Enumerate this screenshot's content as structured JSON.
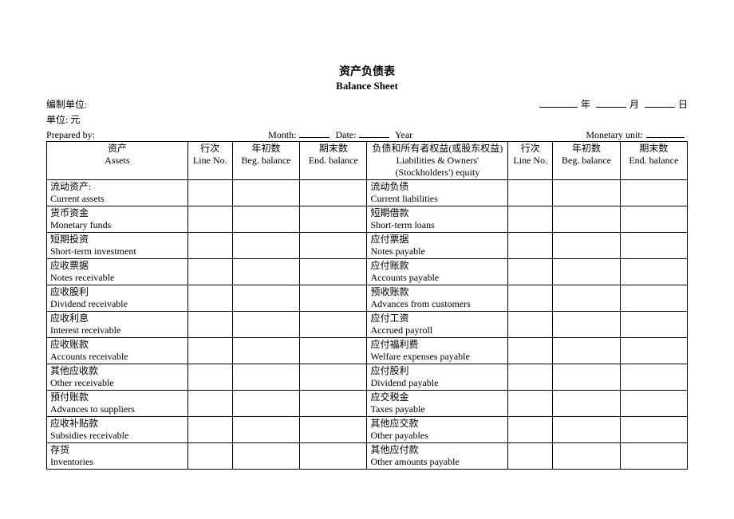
{
  "title_cn": "资产负债表",
  "title_en": "Balance Sheet",
  "meta": {
    "prep_unit_label": "编制单位:",
    "unit_label": "单位: 元",
    "year_label": "年",
    "month_label": "月",
    "day_label": "日",
    "prepared_by_label": "Prepared by:",
    "month_en": "Month:",
    "date_en": "Date:",
    "year_en": "Year",
    "monetary_unit_label": "Monetary unit:"
  },
  "headers": {
    "assets_cn": "资产",
    "assets_en": "Assets",
    "line_cn": "行次",
    "line_en": "Line No.",
    "beg_cn": "年初数",
    "beg_en": "Beg. balance",
    "end_cn": "期末数",
    "end_en": "End. balance",
    "liab_cn": "负债和所有者权益(或股东权益)",
    "liab_en": "Liabilities & Owners' (Stockholders') equity"
  },
  "rows": [
    {
      "a_cn": "流动资产:",
      "a_en": "Current assets",
      "l_cn": "流动负债",
      "l_en": "Current liabilities"
    },
    {
      "a_cn": "货币资金",
      "a_en": "Monetary funds",
      "l_cn": "短期借款",
      "l_en": "Short-term loans"
    },
    {
      "a_cn": "短期投资",
      "a_en": "Short-term investment",
      "l_cn": "应付票据",
      "l_en": "Notes payable"
    },
    {
      "a_cn": "应收票据",
      "a_en": "Notes receivable",
      "l_cn": "应付账款",
      "l_en": "Accounts payable"
    },
    {
      "a_cn": "应收股利",
      "a_en": "Dividend receivable",
      "l_cn": "预收账款",
      "l_en": "Advances from customers"
    },
    {
      "a_cn": "应收利息",
      "a_en": "Interest receivable",
      "l_cn": "应付工资",
      "l_en": "Accrued payroll"
    },
    {
      "a_cn": "应收账款",
      "a_en": "Accounts receivable",
      "l_cn": "应付福利费",
      "l_en": "Welfare expenses payable"
    },
    {
      "a_cn": "其他应收款",
      "a_en": "Other receivable",
      "l_cn": "应付股利",
      "l_en": "Dividend payable"
    },
    {
      "a_cn": "预付账款",
      "a_en": "Advances to suppliers",
      "l_cn": "应交税金",
      "l_en": "Taxes payable"
    },
    {
      "a_cn": "应收补贴款",
      "a_en": "Subsidies receivable",
      "l_cn": "其他应交款",
      "l_en": "Other payables"
    },
    {
      "a_cn": "存货",
      "a_en": "Inventories",
      "l_cn": "其他应付款",
      "l_en": "Other amounts payable"
    }
  ],
  "chart_data": {
    "type": "table",
    "title": "资产负债表 Balance Sheet",
    "columns_left": [
      "资产 Assets",
      "行次 Line No.",
      "年初数 Beg. balance",
      "期末数 End. balance"
    ],
    "columns_right": [
      "负债和所有者权益(或股东权益) Liabilities & Owners' (Stockholders') equity",
      "行次 Line No.",
      "年初数 Beg. balance",
      "期末数 End. balance"
    ],
    "assets": [
      "流动资产: Current assets",
      "货币资金 Monetary funds",
      "短期投资 Short-term investment",
      "应收票据 Notes receivable",
      "应收股利 Dividend receivable",
      "应收利息 Interest receivable",
      "应收账款 Accounts receivable",
      "其他应收款 Other receivable",
      "预付账款 Advances to suppliers",
      "应收补贴款 Subsidies receivable",
      "存货 Inventories"
    ],
    "liabilities": [
      "流动负债 Current liabilities",
      "短期借款 Short-term loans",
      "应付票据 Notes payable",
      "应付账款 Accounts payable",
      "预收账款 Advances from customers",
      "应付工资 Accrued payroll",
      "应付福利费 Welfare expenses payable",
      "应付股利 Dividend payable",
      "应交税金 Taxes payable",
      "其他应交款 Other payables",
      "其他应付款 Other amounts payable"
    ]
  }
}
